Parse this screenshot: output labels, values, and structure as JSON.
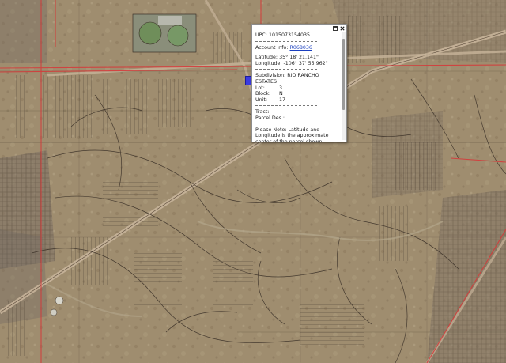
{
  "map": {
    "base_color": "#9c8a6c",
    "parcel_line_color": "#3b3128",
    "boundary_line_color": "#d43b3b",
    "road_color": "#c7b49a"
  },
  "popup": {
    "upc_label": "UPC:",
    "upc_value": "1015073154035",
    "account_label": "Account Info:",
    "account_value": "R068036",
    "latitude_label": "Latitude:",
    "latitude_value": "35° 18' 21.141\"",
    "longitude_label": "Longitude:",
    "longitude_value": "-106° 37' 55.962\"",
    "subdivision_label": "Subdivision:",
    "subdivision_value": "RIO RANCHO ESTATES",
    "lot_label": "Lot:",
    "lot_value": "3",
    "block_label": "Block:",
    "block_value": "N",
    "unit_label": "Unit:",
    "unit_value": "17",
    "tract_label": "Tract:",
    "parcel_des_label": "Parcel Des.:",
    "note": "Please Note: Latitude and Longitude is the approximate center of the parcel shown",
    "maximize_icon": "maximize-icon",
    "close_icon": "close-icon"
  }
}
